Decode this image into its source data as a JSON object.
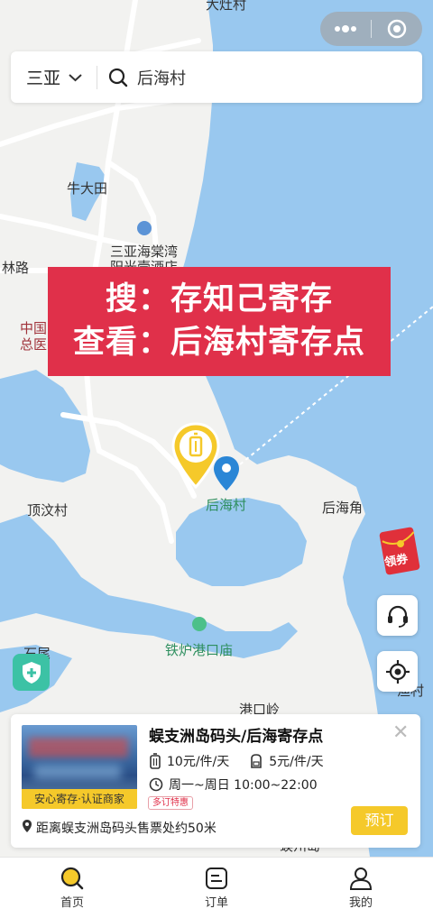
{
  "map": {
    "labels": {
      "top_partial": "大灶村",
      "niudatian": "牛大田",
      "hotel_line1": "三亚海棠湾",
      "hotel_line2": "阳光壹酒店",
      "lin_road": "林路",
      "hospital_line1": "中国",
      "hospital_line2": "总医",
      "houhai_village": "后海村",
      "houhai_cape": "后海角",
      "dingwen_village": "顶汶村",
      "tielu_temple": "铁炉港口庙",
      "shiwei": "石尾",
      "gangkouling": "港口岭",
      "right_edge": "渔村",
      "bottom_edge": "蜈州岛"
    }
  },
  "capsule": {
    "more_icon": "more-dots-icon",
    "close_icon": "target-circle-icon"
  },
  "search": {
    "city": "三亚",
    "query": "后海村"
  },
  "banner": {
    "line1": "搜：存知己寄存",
    "line2": "查看：后海村寄存点"
  },
  "red_envelope": {
    "label": "领券"
  },
  "card": {
    "title": "蜈支洲岛码头/后海寄存点",
    "thumb_badge": "安心寄存·认证商家",
    "price_luggage": "10元/件/天",
    "price_bag": "5元/件/天",
    "hours": "周一~周日 10:00~22:00",
    "promo": "多订特惠",
    "distance": "距离蜈支洲岛码头售票处约50米",
    "book_label": "预订"
  },
  "tabs": [
    {
      "label": "首页",
      "icon": "search-home-icon",
      "active": true
    },
    {
      "label": "订单",
      "icon": "order-icon",
      "active": false
    },
    {
      "label": "我的",
      "icon": "profile-icon",
      "active": false
    }
  ],
  "colors": {
    "water": "#99c8ef",
    "land": "#f2f2f0",
    "accent": "#f5c92a",
    "banner": "#e0304a"
  }
}
